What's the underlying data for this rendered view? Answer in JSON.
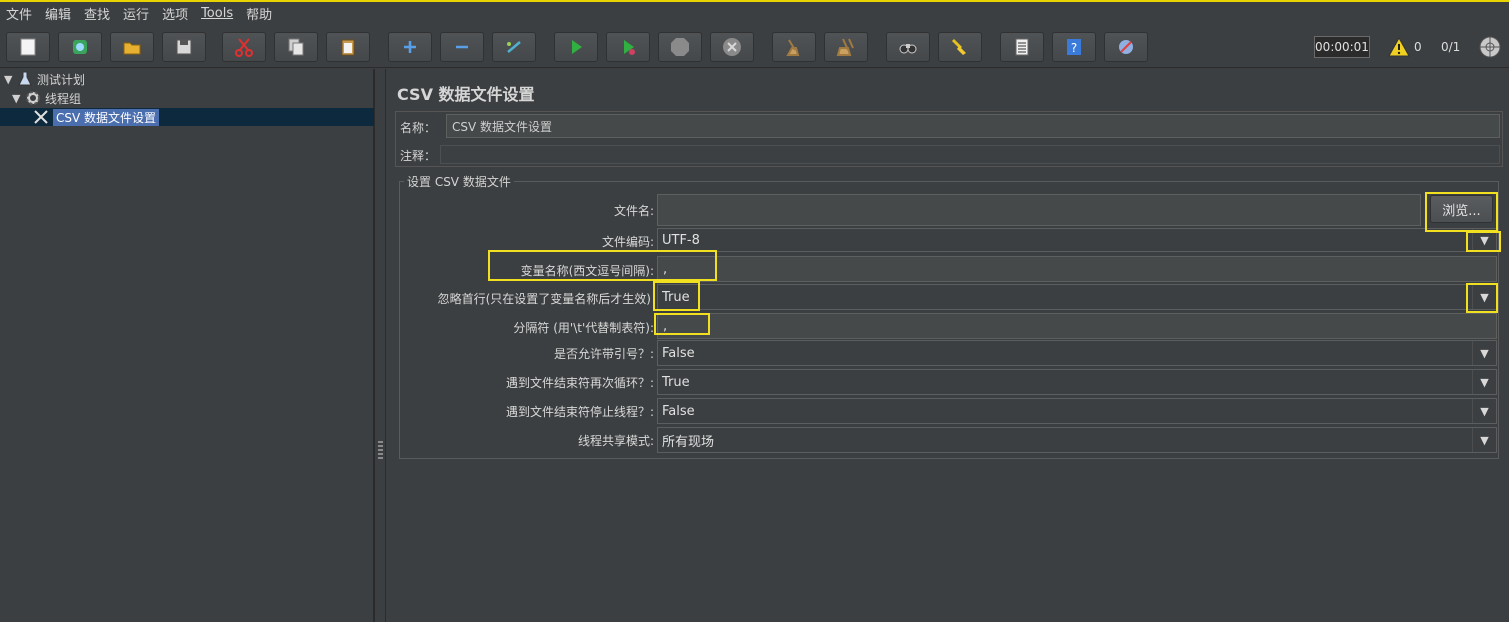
{
  "menu": {
    "items": [
      {
        "label": "文件"
      },
      {
        "label": "编辑"
      },
      {
        "label": "查找"
      },
      {
        "label": "运行"
      },
      {
        "label": "选项"
      },
      {
        "label": "Tools"
      },
      {
        "label": "帮助"
      }
    ]
  },
  "status": {
    "timer": "00:00:01",
    "warnings": "0",
    "threads": "0/1"
  },
  "tree": {
    "root": "测试计划",
    "group": "线程组",
    "selected": "CSV 数据文件设置"
  },
  "panel": {
    "title": "CSV 数据文件设置",
    "name_label": "名称：",
    "name_value": "CSV 数据文件设置",
    "comment_label": "注释：",
    "comment_value": "",
    "group_title": "设置 CSV 数据文件"
  },
  "form": {
    "filename_label": "文件名:",
    "filename_value": "",
    "browse_label": "浏览...",
    "encoding_label": "文件编码:",
    "encoding_value": "UTF-8",
    "varnames_label": "变量名称(西文逗号间隔):",
    "varnames_value": ",",
    "ignore_label": "忽略首行(只在设置了变量名称后才生效)",
    "ignore_value": "True",
    "delimiter_label": "分隔符 (用'\\t'代替制表符):",
    "delimiter_value": ",",
    "quoted_label": "是否允许带引号？:",
    "quoted_value": "False",
    "recycle_label": "遇到文件结束符再次循环？:",
    "recycle_value": "True",
    "stop_label": "遇到文件结束符停止线程？:",
    "stop_value": "False",
    "share_label": "线程共享模式:",
    "share_value": "所有现场"
  },
  "colors": {
    "highlight": "#f0e020",
    "background": "#3c3f41",
    "selection": "#4b6eaf"
  }
}
